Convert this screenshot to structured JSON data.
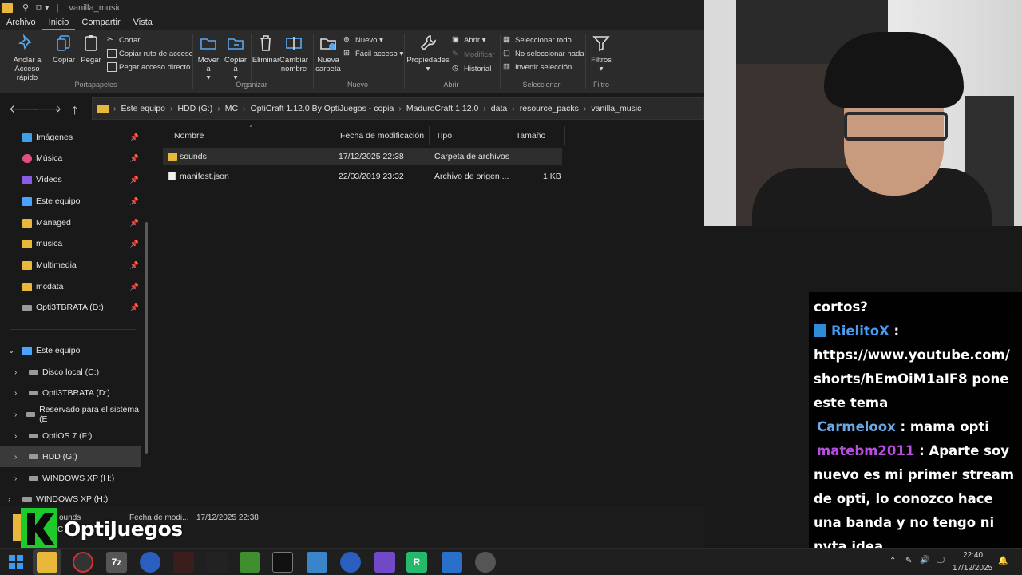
{
  "window": {
    "title": "vanilla_music"
  },
  "menu_tabs": [
    "Archivo",
    "Inicio",
    "Compartir",
    "Vista"
  ],
  "ribbon": {
    "pin_label": "Anclar a Acceso rápido",
    "copy_label": "Copiar",
    "paste_label": "Pegar",
    "cut_label": "Cortar",
    "copy_path_label": "Copiar ruta de acceso",
    "paste_shortcut_label": "Pegar acceso directo",
    "group_portapapeles": "Portapapeles",
    "move_label": "Mover a",
    "copyto_label": "Copiar a",
    "delete_label": "Eliminar",
    "rename_label": "Cambiar nombre",
    "group_organizar": "Organizar",
    "new_folder_label": "Nueva carpeta",
    "new_item_label": "Nuevo",
    "easy_access_label": "Fácil acceso",
    "group_nuevo": "Nuevo",
    "properties_label": "Propiedades",
    "open_label": "Abrir",
    "edit_label": "Modificar",
    "history_label": "Historial",
    "group_abrir": "Abrir",
    "select_all_label": "Seleccionar todo",
    "select_none_label": "No seleccionar nada",
    "invert_label": "Invertir selección",
    "group_seleccionar": "Seleccionar",
    "filters_label": "Filtros",
    "group_filtro": "Filtro"
  },
  "breadcrumb": [
    "Este equipo",
    "HDD (G:)",
    "MC",
    "OptiCraft 1.12.0 By OptiJuegos - copia",
    "MaduroCraft 1.12.0",
    "data",
    "resource_packs",
    "vanilla_music"
  ],
  "nav_pinned": [
    {
      "label": "Imágenes",
      "color": "#3fa0e6"
    },
    {
      "label": "Música",
      "color": "#e0507a"
    },
    {
      "label": "Vídeos",
      "color": "#8a5ce6"
    },
    {
      "label": "Este equipo",
      "color": "#4aa3ff"
    },
    {
      "label": "Managed",
      "color": "#e9b83a"
    },
    {
      "label": "musica",
      "color": "#e9b83a"
    },
    {
      "label": "Multimedia",
      "color": "#e9b83a"
    },
    {
      "label": "mcdata",
      "color": "#e9b83a"
    },
    {
      "label": "Opti3TBRATA (D:)",
      "color": "#9a9a9a"
    }
  ],
  "nav_tree": {
    "root": "Este equipo",
    "drives": [
      "Disco local (C:)",
      "Opti3TBRATA (D:)",
      "Reservado para el sistema (E",
      "OptiOS 7 (F:)",
      "HDD (G:)",
      "WINDOWS XP (H:)"
    ],
    "extra": "WINDOWS XP (H:)"
  },
  "columns": [
    "Nombre",
    "Fecha de modificación",
    "Tipo",
    "Tamaño"
  ],
  "files": [
    {
      "name": "sounds",
      "date": "17/12/2025 22:38",
      "type": "Carpeta de archivos",
      "size": ""
    },
    {
      "name": "manifest.json",
      "date": "22/03/2019 23:32",
      "type": "Archivo de origen ...",
      "size": "1 KB"
    }
  ],
  "status": {
    "item_name": "ounds",
    "item_sub": "C",
    "date_label": "Fecha de modi...",
    "date_value": "17/12/2025 22:38"
  },
  "logo": {
    "text": "OptiJuegos",
    "color": "#1ec92a"
  },
  "chat": {
    "lead": "cortos?",
    "messages": [
      {
        "user": "RielitoX",
        "user_color": "#4a9cf0",
        "sep": " : ",
        "text": "https://www.youtube.com/shorts/hEmOiM1aIF8 pone este tema"
      },
      {
        "user": "Carmeloox",
        "user_color": "#6aa8e8",
        "sep": " : ",
        "text": "mama opti"
      },
      {
        "user": "matebm2011",
        "user_color": "#b94fe0",
        "sep": " : ",
        "text": "Aparte soy nuevo es mi primer stream de opti, lo conozco hace una banda y no tengo ni pvta idea"
      }
    ]
  },
  "taskbar": {
    "time": "22:40",
    "date": "17/12/2025"
  }
}
